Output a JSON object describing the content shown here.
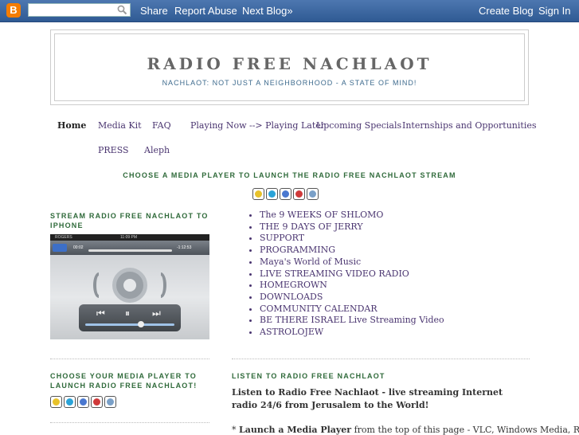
{
  "navbar": {
    "logo": "B",
    "search_placeholder": "",
    "links": [
      "Share",
      "Report Abuse",
      "Next Blog»"
    ],
    "right_links": [
      "Create Blog",
      "Sign In"
    ]
  },
  "header": {
    "title": "RADIO FREE NACHLAOT",
    "tagline": "NACHLAOT: NOT JUST A NEIGHBORHOOD - A STATE OF MIND!"
  },
  "tabs": [
    "Home",
    "Media Kit",
    "FAQ",
    "Playing Now --> Playing Later",
    "Upcoming Specials",
    "Internships and Opportunities",
    "PRESS",
    "Aleph"
  ],
  "center_heading": "CHOOSE A MEDIA PLAYER TO LAUNCH THE RADIO FREE NACHLAOT STREAM",
  "player_icons": [
    {
      "name": "winamp-icon",
      "color": "#e8c22a"
    },
    {
      "name": "vlc-icon",
      "color": "#2aa3d8"
    },
    {
      "name": "itunes-icon",
      "color": "#4a78d0"
    },
    {
      "name": "real-player-icon",
      "color": "#d03a3a"
    },
    {
      "name": "quicktime-icon",
      "color": "#7aa0c8"
    }
  ],
  "sidebar": {
    "iphone_heading": "STREAM RADIO FREE NACHLAOT TO IPHONE",
    "iphone_status": {
      "carrier": "ROGERS",
      "time": "11:09 PM",
      "elapsed": "00:02",
      "remaining": "-1:12:53",
      "done": "Done"
    },
    "players_heading": "CHOOSE YOUR MEDIA PLAYER TO LAUNCH RADIO FREE NACHLAOT!"
  },
  "links": [
    "The 9 WEEKS OF SHLOMO",
    "THE 9 DAYS OF JERRY",
    "SUPPORT",
    "PROGRAMMING",
    "Maya's World of Music",
    "LIVE STREAMING VIDEO RADIO",
    "HOMEGROWN",
    "DOWNLOADS",
    "COMMUNITY CALENDAR",
    "BE THERE ISRAEL Live Streaming Video",
    "ASTROLOJEW"
  ],
  "post": {
    "title": "LISTEN TO RADIO FREE NACHLAOT",
    "intro": "Listen to Radio Free Nachlaot - live streaming Internet radio 24/6 from Jerusalem to the World!",
    "step_prefix": "* ",
    "step_bold": "Launch a Media Player",
    "step_rest": " from the top of this page - VLC, Windows Media, Real"
  }
}
